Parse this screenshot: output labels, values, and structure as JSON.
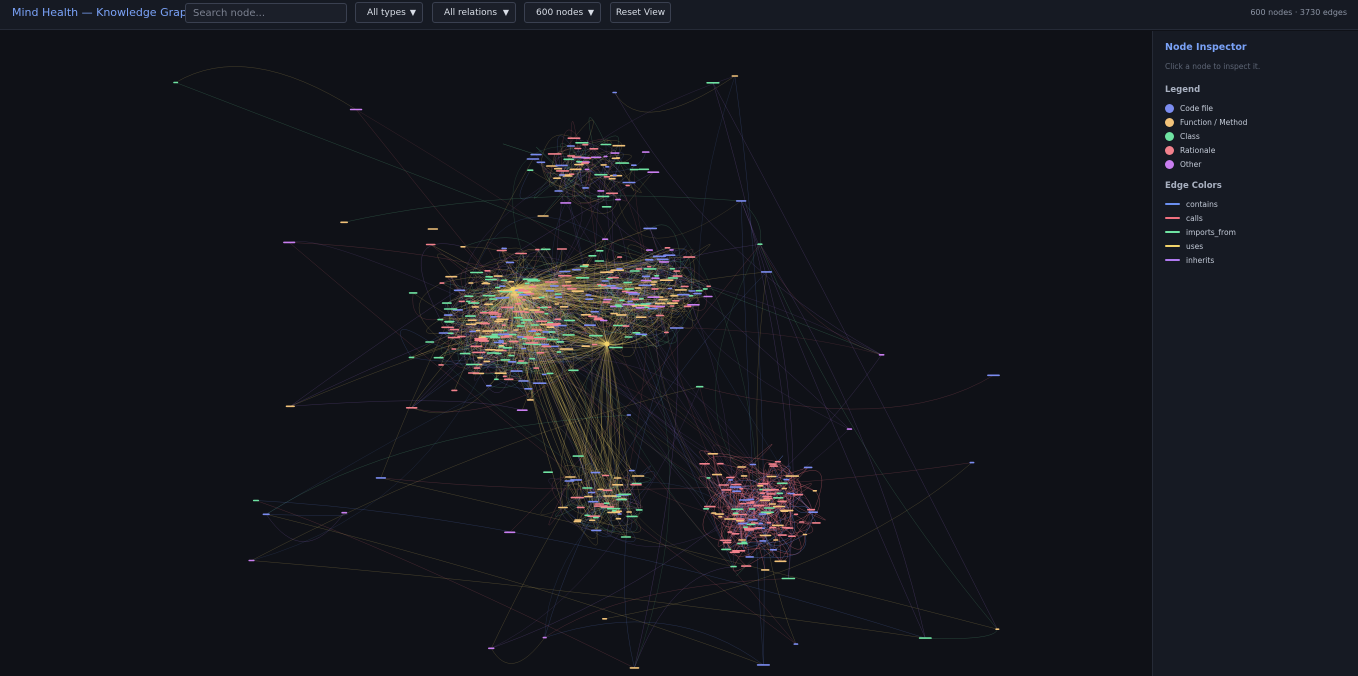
{
  "header": {
    "title": "Mind Health — Knowledge Graph",
    "search_placeholder": "Search node...",
    "type_filter": "All types",
    "relation_filter": "All relations",
    "node_limit": "600 nodes",
    "reset_label": "Reset View",
    "stats": "600 nodes · 3730 edges"
  },
  "inspector": {
    "title": "Node Inspector",
    "hint": "Click a node to inspect it."
  },
  "legend": {
    "title": "Legend",
    "items": [
      {
        "label": "Code file",
        "color": "#7b8cf0"
      },
      {
        "label": "Function / Method",
        "color": "#f2c37a"
      },
      {
        "label": "Class",
        "color": "#6fe3a2"
      },
      {
        "label": "Rationale",
        "color": "#f2818c"
      },
      {
        "label": "Other",
        "color": "#c97ef0"
      }
    ]
  },
  "edge_legend": {
    "title": "Edge Colors",
    "items": [
      {
        "label": "contains",
        "color": "#6b8ff0"
      },
      {
        "label": "calls",
        "color": "#f0707f"
      },
      {
        "label": "imports_from",
        "color": "#6fe3a2"
      },
      {
        "label": "uses",
        "color": "#f2d36a"
      },
      {
        "label": "inherits",
        "color": "#b07af0"
      }
    ]
  },
  "graph": {
    "node_count": 600,
    "edge_count": 3730
  }
}
